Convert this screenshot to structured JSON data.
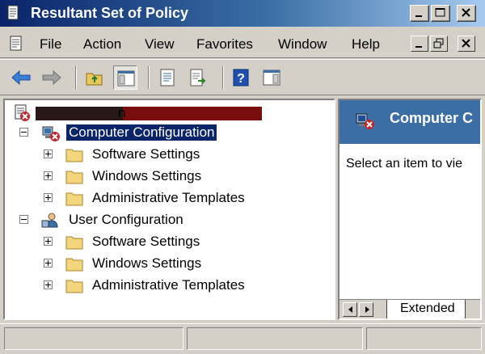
{
  "window": {
    "title": "Resultant Set of Policy",
    "icon": "rsop-scroll-icon"
  },
  "menubar": {
    "items": [
      "File",
      "Action",
      "View",
      "Favorites",
      "Window",
      "Help"
    ]
  },
  "toolbar": {
    "buttons": [
      "back-arrow-icon",
      "forward-arrow-icon",
      "up-folder-icon",
      "show-hide-tree-icon",
      "properties-icon",
      "export-list-icon",
      "help-icon",
      "show-hide-action-pane-icon"
    ]
  },
  "tree": {
    "root_label_visible_suffix": "n",
    "computer_configuration": {
      "label": "Computer Configuration",
      "expanded": true,
      "selected": true,
      "children": [
        "Software Settings",
        "Windows Settings",
        "Administrative Templates"
      ]
    },
    "user_configuration": {
      "label": "User Configuration",
      "expanded": true,
      "children": [
        "Software Settings",
        "Windows Settings",
        "Administrative Templates"
      ]
    }
  },
  "detail_pane": {
    "title": "Computer C",
    "message": "Select an item to vie",
    "tab": "Extended"
  },
  "colors": {
    "titlebar_start": "#0a246a",
    "titlebar_end": "#a6caf0",
    "selection": "#0a246a",
    "detail_header": "#3a6ea5",
    "window_face": "#d4d0c8"
  }
}
